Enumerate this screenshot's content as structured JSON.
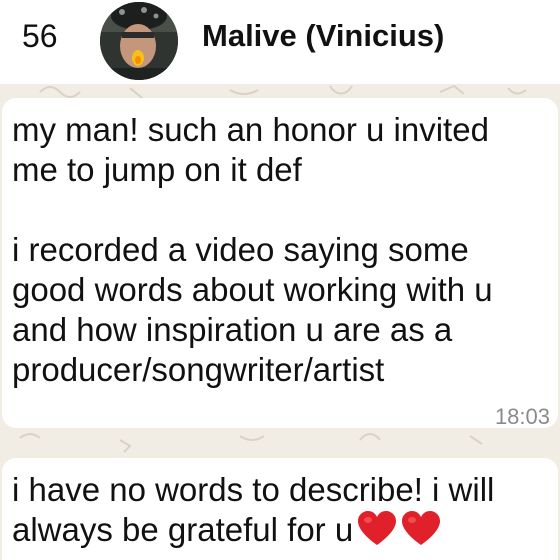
{
  "header": {
    "back_count": "56",
    "contact_name": "Malive (Vinicius)"
  },
  "messages": [
    {
      "text": "my man! such an honor u invited\nme to jump on it def\n\ni recorded a video saying some\ngood words about working with u\nand how inspiration u are as a\nproducer/songwriter/artist",
      "time": "18:03"
    },
    {
      "text": "i have no words to describe! i will\nalways be grateful for u",
      "emoji": "red-heart-icon"
    }
  ],
  "colors": {
    "chat_background": "#f1ece4",
    "bubble": "#ffffff",
    "header": "#ffffff",
    "timestamp": "#8a8a8a",
    "heart": "#e0202a"
  }
}
